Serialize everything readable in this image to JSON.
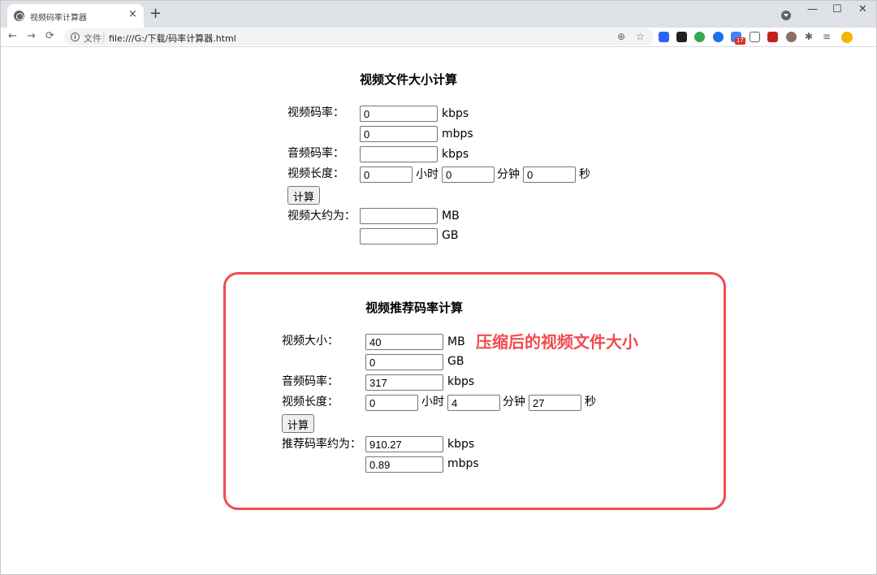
{
  "browser": {
    "tab_title": "视频码率计算器",
    "tab_close": "×",
    "new_tab": "+",
    "minimize": "—",
    "maximize": "☐",
    "close": "✕",
    "back": "←",
    "forward": "→",
    "reload": "⟳",
    "info_glyph": "i",
    "scheme_label": "文件",
    "separator": "|",
    "url": "file:///G:/下载/码率计算器.html",
    "zoom_icon": "⊕",
    "star_icon": "☆",
    "extension_badge": "17",
    "puzzle_icon": "✱",
    "reading_list_icon": "≡"
  },
  "file_size_calc": {
    "heading": "视频文件大小计算",
    "video_bitrate_label": "视频码率：",
    "video_kbps_value": "0",
    "unit_kbps": "kbps",
    "video_mbps_value": "0",
    "unit_mbps": "mbps",
    "audio_bitrate_label": "音频码率：",
    "audio_kbps_value": "",
    "audio_unit_kbps": "kbps",
    "length_label": "视频长度：",
    "hours_value": "0",
    "hours_unit": "小时",
    "minutes_value": "0",
    "minutes_unit": "分钟",
    "seconds_value": "0",
    "seconds_unit": "秒",
    "calc_button": "计算",
    "result_label": "视频大约为：",
    "result_mb_value": "",
    "unit_mb": "MB",
    "result_gb_value": "",
    "unit_gb": "GB"
  },
  "bitrate_calc": {
    "heading": "视频推荐码率计算",
    "size_label": "视频大小：",
    "size_mb_value": "40",
    "unit_mb": "MB",
    "size_gb_value": "0",
    "unit_gb": "GB",
    "audio_bitrate_label": "音频码率：",
    "audio_kbps_value": "317",
    "audio_unit_kbps": "kbps",
    "length_label": "视频长度：",
    "hours_value": "0",
    "hours_unit": "小时",
    "minutes_value": "4",
    "minutes_unit": "分钟",
    "seconds_value": "27",
    "seconds_unit": "秒",
    "calc_button": "计算",
    "result_label": "推荐码率约为：",
    "result_kbps_value": "910.27",
    "unit_kbps": "kbps",
    "result_mbps_value": "0.89",
    "unit_mbps": "mbps"
  },
  "annotation": {
    "text": "压缩后的视频文件大小",
    "color": "#f04b4f"
  }
}
